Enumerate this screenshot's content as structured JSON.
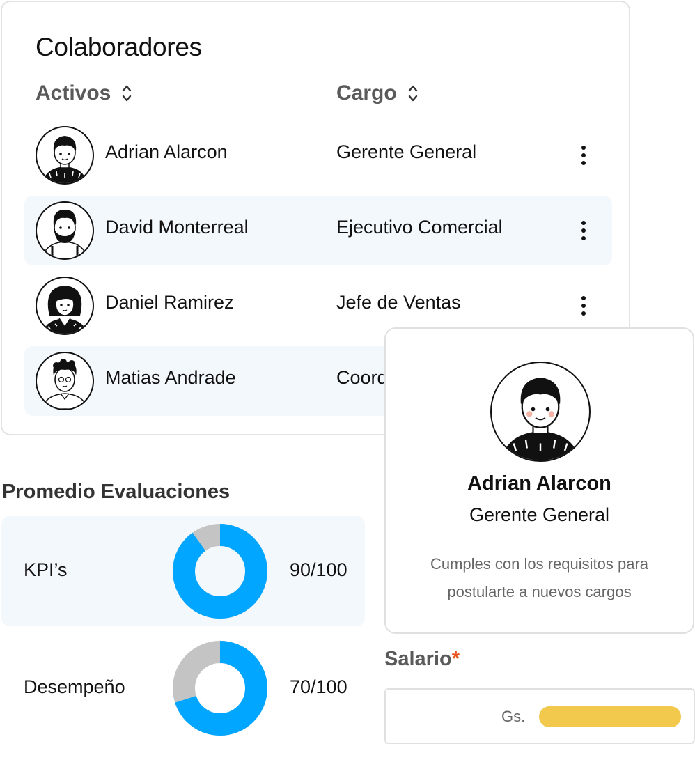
{
  "card": {
    "title": "Colaboradores",
    "columns": {
      "active": "Activos",
      "role": "Cargo"
    },
    "rows": [
      {
        "name": "Adrian Alarcon",
        "role": "Gerente General"
      },
      {
        "name": "David Monterreal",
        "role": "Ejecutivo Comercial"
      },
      {
        "name": "Daniel Ramirez",
        "role": "Jefe de Ventas"
      },
      {
        "name": "Matias Andrade",
        "role": "Coord"
      }
    ]
  },
  "evaluations": {
    "title": "Promedio Evaluaciones",
    "items": [
      {
        "label": "KPI’s",
        "value": "90/100",
        "score": 90
      },
      {
        "label": "Desempeño",
        "value": "70/100",
        "score": 70
      }
    ],
    "colors": {
      "filled": "#00a6ff",
      "empty": "#c4c4c4"
    }
  },
  "profile": {
    "name": "Adrian Alarcon",
    "role": "Gerente General",
    "message": "Cumples con los requisitos para postularte a nuevos cargos"
  },
  "salary": {
    "label": "Salario",
    "required_mark": "*",
    "prefix": "Gs."
  }
}
